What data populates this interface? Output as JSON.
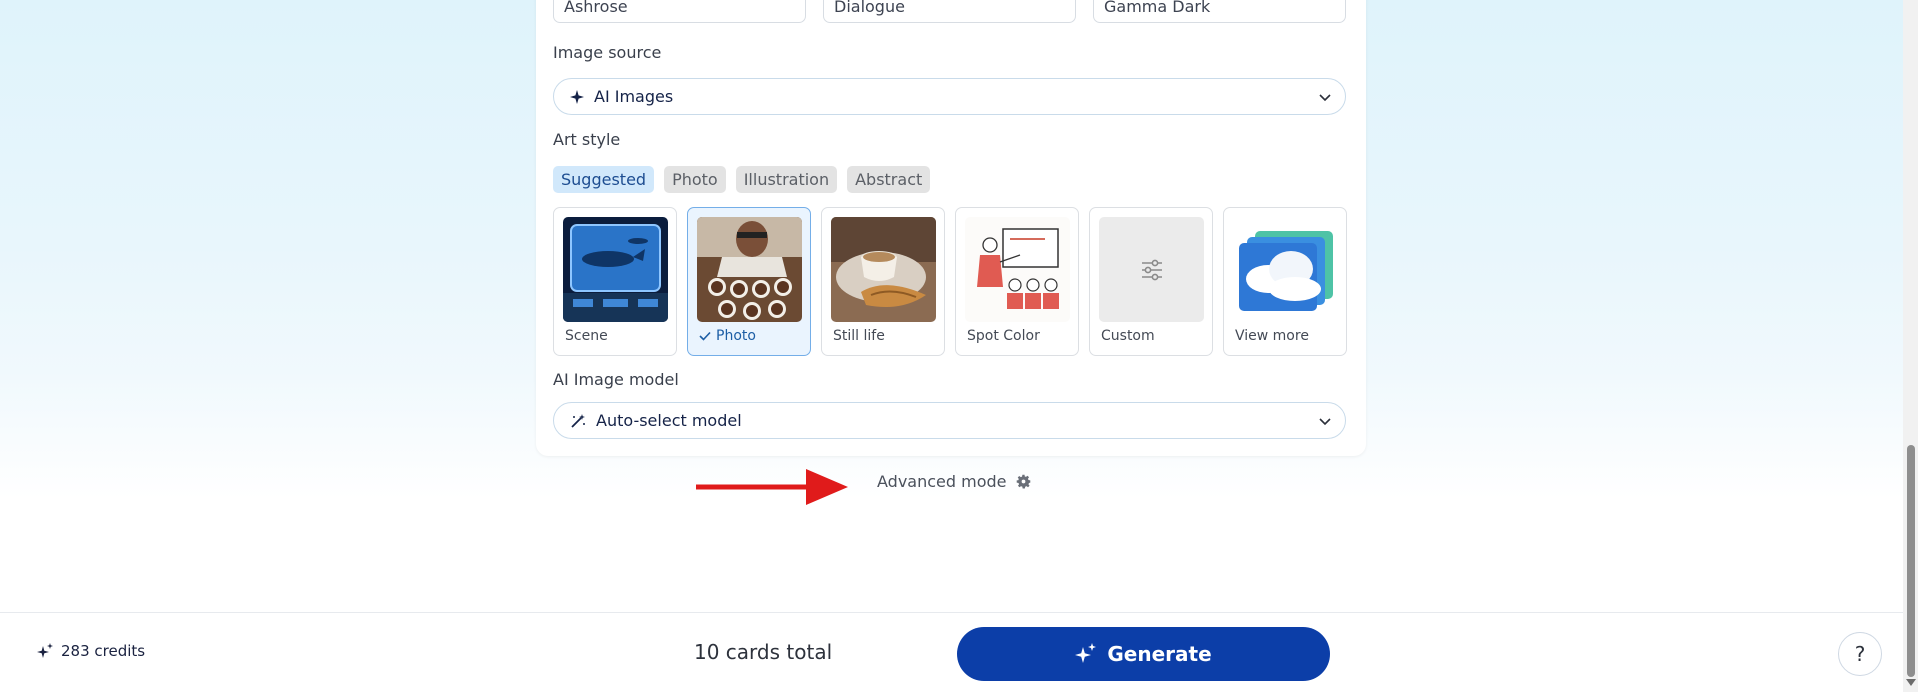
{
  "top_inputs": [
    "Ashrose",
    "Dialogue",
    "Gamma Dark"
  ],
  "image_source": {
    "label": "Image source",
    "value": "AI Images",
    "icon": "sparkle-icon"
  },
  "art_style": {
    "label": "Art style",
    "chips": [
      "Suggested",
      "Photo",
      "Illustration",
      "Abstract"
    ],
    "active_chip": "Suggested",
    "cards": [
      {
        "label": "Scene",
        "selected": false
      },
      {
        "label": "Photo",
        "selected": true
      },
      {
        "label": "Still life",
        "selected": false
      },
      {
        "label": "Spot Color",
        "selected": false
      },
      {
        "label": "Custom",
        "selected": false
      },
      {
        "label": "View more",
        "selected": false
      }
    ]
  },
  "ai_model": {
    "label": "AI Image model",
    "value": "Auto-select model",
    "icon": "magic-wand-icon"
  },
  "advanced_mode": "Advanced mode",
  "footer": {
    "credits": "283 credits",
    "total": "10 cards total",
    "generate_label": "Generate",
    "help": "?"
  },
  "colors": {
    "primary": "#0c3ea8",
    "annotation_arrow": "#e01b1b",
    "chip_active_bg": "#d1e8fb"
  }
}
